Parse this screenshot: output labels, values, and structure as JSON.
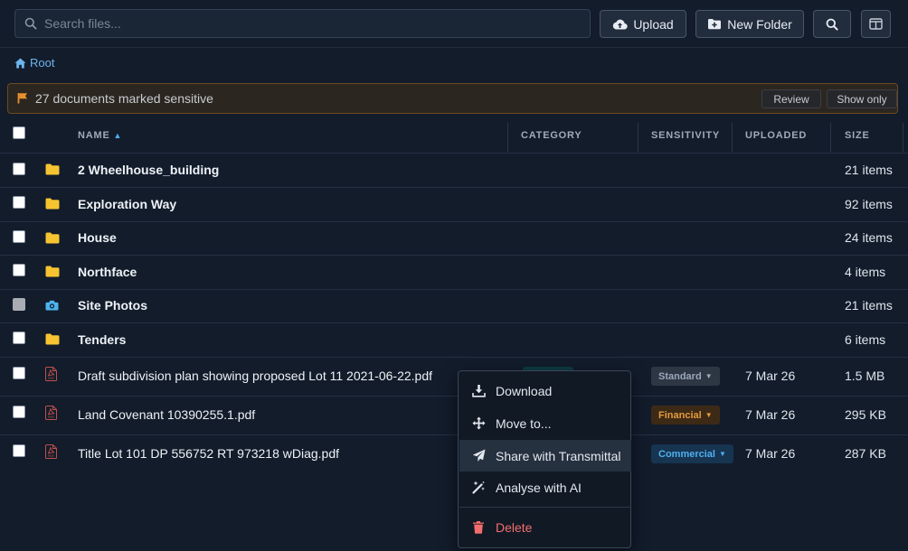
{
  "toolbar": {
    "search_placeholder": "Search files...",
    "upload_label": "Upload",
    "new_folder_label": "New Folder"
  },
  "breadcrumb": {
    "root_label": "Root"
  },
  "banner": {
    "text": "27 documents marked sensitive",
    "review_label": "Review",
    "show_only_label": "Show only",
    "accent": "#e8902c"
  },
  "table": {
    "columns": {
      "name": "NAME",
      "category": "CATEGORY",
      "sensitivity": "SENSITIVITY",
      "uploaded": "UPLOADED",
      "size": "SIZE"
    },
    "sort_indicator": "▲",
    "rows": [
      {
        "icon": "folder-icon",
        "name": "2 Wheelhouse_building",
        "size": "21 items"
      },
      {
        "icon": "folder-icon",
        "name": "Exploration Way",
        "size": "92 items"
      },
      {
        "icon": "folder-icon",
        "name": "House",
        "size": "24 items"
      },
      {
        "icon": "folder-icon",
        "name": "Northface",
        "size": "4 items"
      },
      {
        "icon": "camera-icon",
        "name": "Site Photos",
        "size": "21 items"
      },
      {
        "icon": "folder-icon",
        "name": "Tenders",
        "size": "6 items"
      },
      {
        "icon": "pdf-icon",
        "name": "Draft subdivision plan showing proposed Lot 11 2021-06-22.pdf",
        "sensitivity": "Standard",
        "uploaded": "7 Mar 26",
        "size": "1.5 MB"
      },
      {
        "icon": "pdf-icon",
        "name": "Land Covenant 10390255.1.pdf",
        "sensitivity": "Financial",
        "uploaded": "7 Mar 26",
        "size": "295 KB"
      },
      {
        "icon": "pdf-icon",
        "name": "Title Lot 101 DP 556752 RT 973218 wDiag.pdf",
        "sensitivity": "Commercial",
        "uploaded": "7 Mar 26",
        "size": "287 KB"
      }
    ]
  },
  "context_menu": {
    "items": [
      {
        "label": "Download",
        "icon": "download-icon"
      },
      {
        "label": "Move to...",
        "icon": "move-icon"
      },
      {
        "label": "Share with Transmittal",
        "icon": "send-icon",
        "hovered": true
      },
      {
        "label": "Analyse with AI",
        "icon": "magic-wand-icon"
      },
      {
        "label": "Delete",
        "icon": "trash-icon",
        "danger": true
      }
    ]
  },
  "colors": {
    "background": "#121c2b",
    "folder": "#f6c431",
    "camera": "#4db3ee",
    "pdf": "#c0504d",
    "link": "#6cb4ee",
    "danger": "#f26d6d"
  }
}
